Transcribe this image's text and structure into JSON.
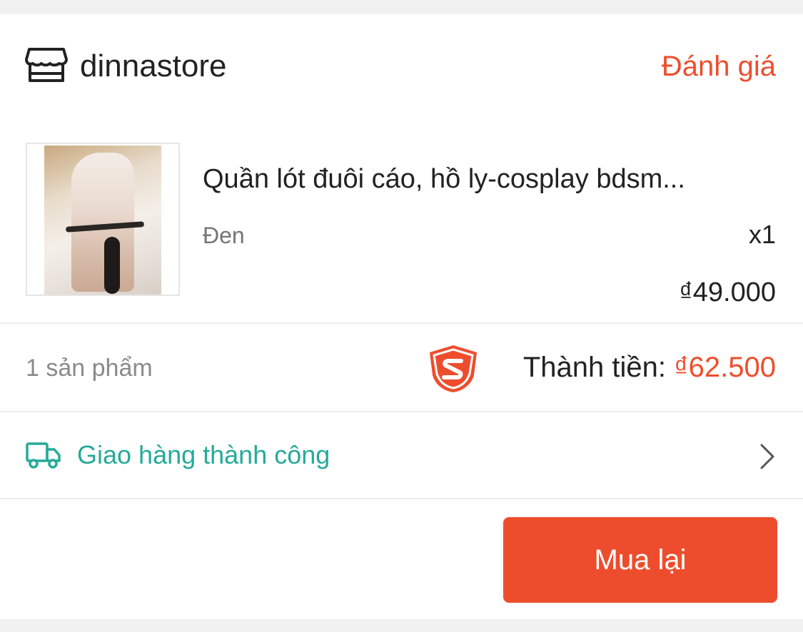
{
  "shop": {
    "name": "dinnastore",
    "rate_label": "Đánh giá",
    "icon": "shop-icon"
  },
  "product": {
    "title": "Quần lót đuôi cáo, hồ ly-cosplay bdsm...",
    "variant": "Đen",
    "quantity": "x1",
    "price": "₫49.000"
  },
  "summary": {
    "count": "1 sản phẩm",
    "total_label": "Thành tiền: ",
    "total_amount": "₫62.500",
    "badge_icon": "shopee-guarantee-shield-icon"
  },
  "delivery": {
    "status": "Giao hàng thành công",
    "icon": "truck-icon"
  },
  "actions": {
    "buy_again": "Mua lại"
  },
  "colors": {
    "accent": "#ee4d2d",
    "teal": "#26aa99",
    "background": "#f1f1f1"
  }
}
